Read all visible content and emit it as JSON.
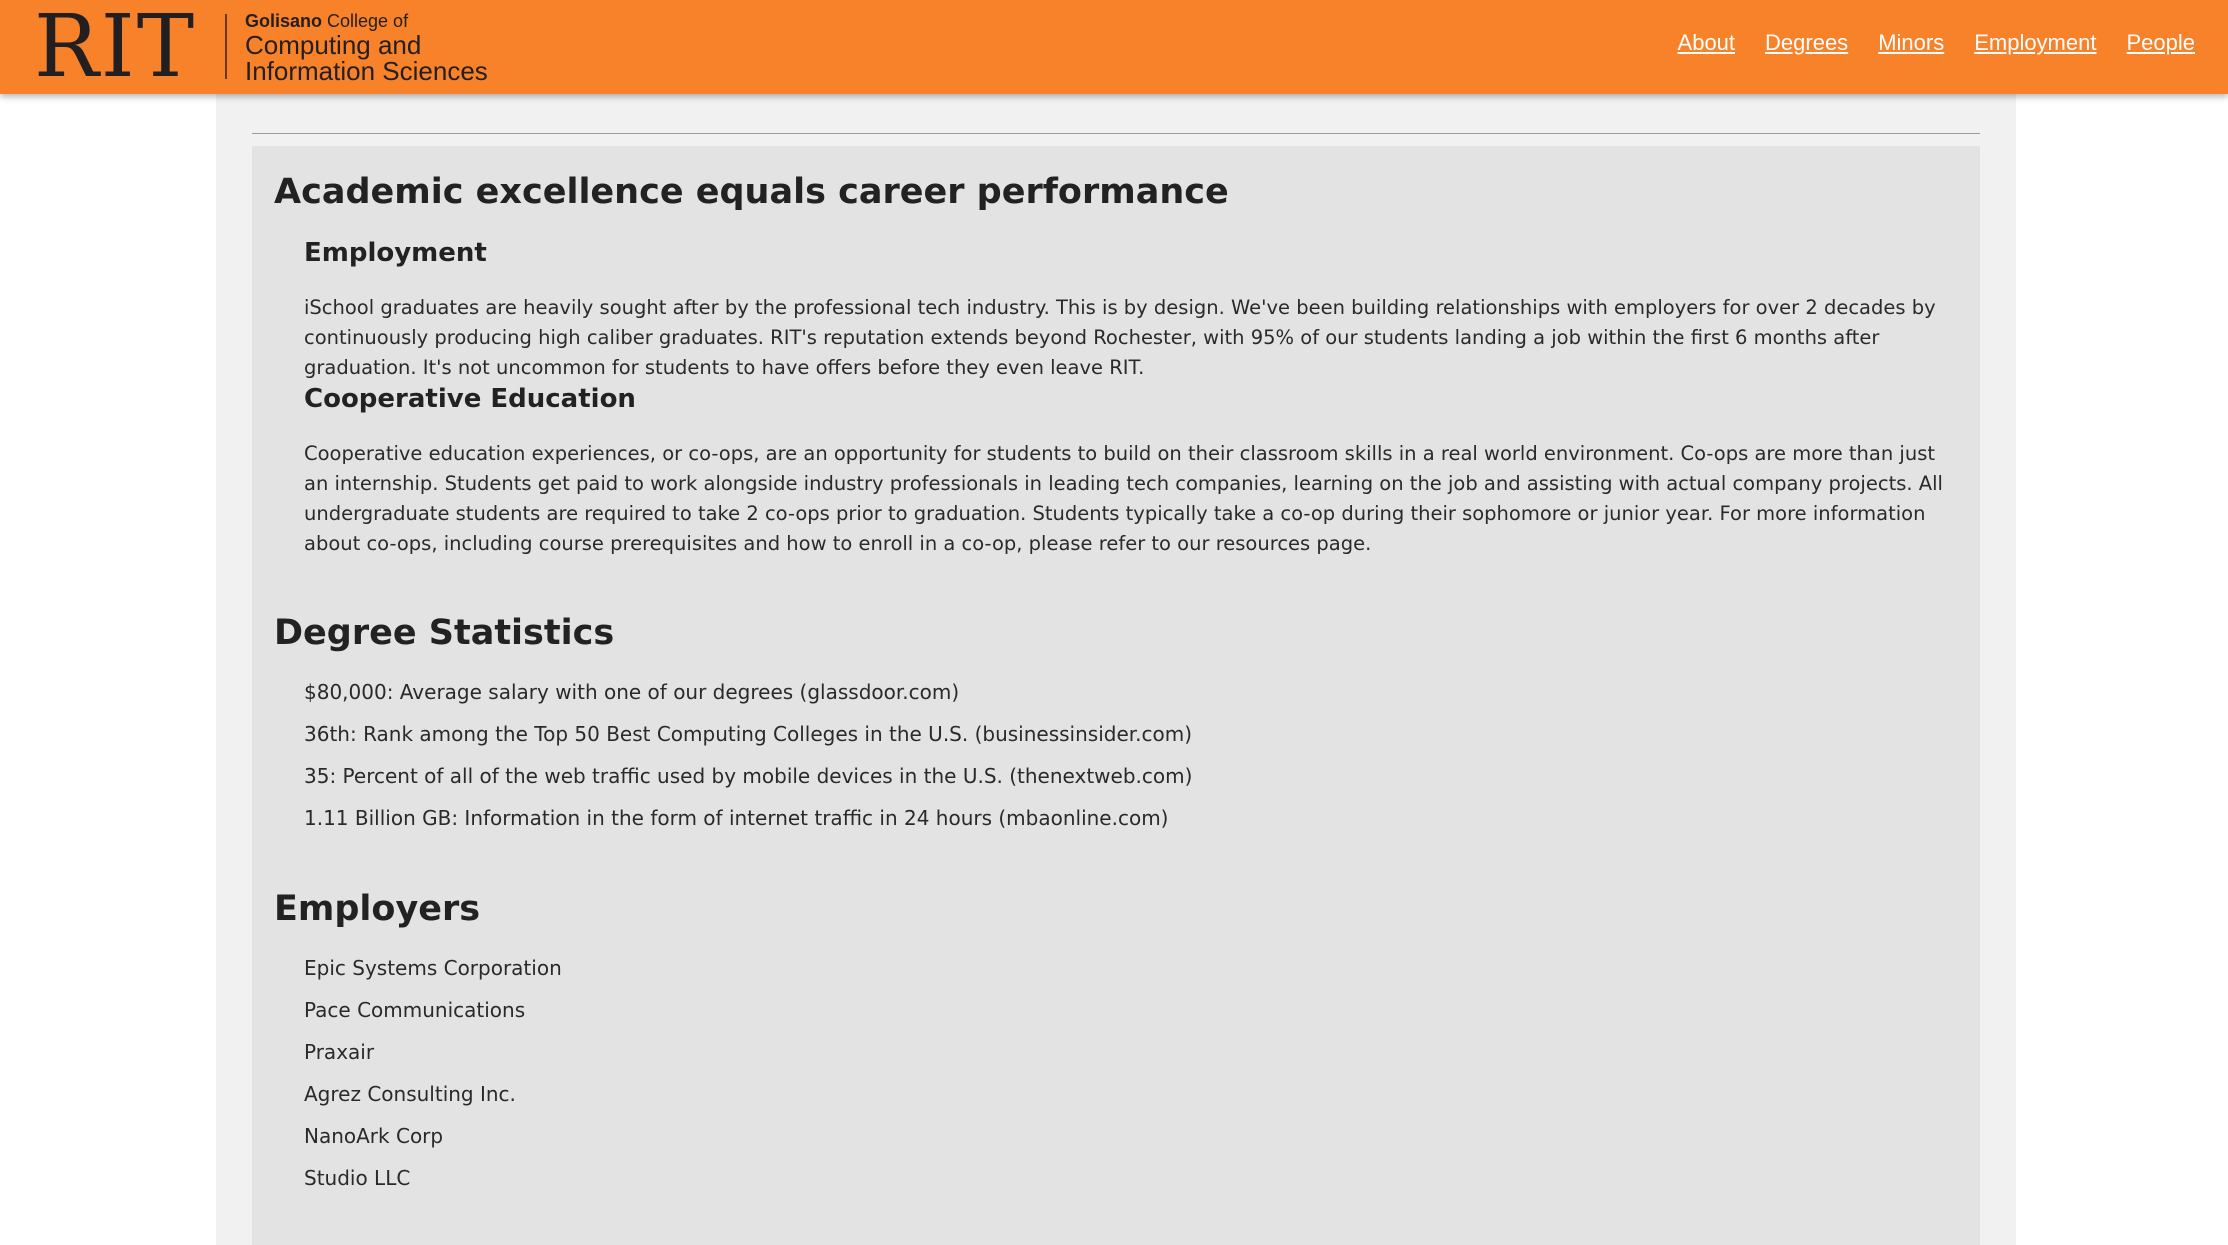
{
  "header": {
    "logo_mark": "RIT",
    "college_bold": "Golisano",
    "college_rest": " College of",
    "college_line2": "Computing and",
    "college_line3": "Information Sciences",
    "nav": [
      "About",
      "Degrees",
      "Minors",
      "Employment",
      "People"
    ]
  },
  "colors": {
    "accent": "#f8822a",
    "panel": "#e4e3e4",
    "frame": "#f1f1f1"
  },
  "intro": {
    "title": "Academic excellence equals career performance",
    "employment_heading": "Employment",
    "employment_text": "iSchool graduates are heavily sought after by the professional tech industry. This is by design. We've been building relationships with employers for over 2 decades by continuously producing high caliber graduates. RIT's reputation extends beyond Rochester, with 95% of our students landing a job within the first 6 months after graduation. It's not uncommon for students to have offers before they even leave RIT.",
    "coop_heading": "Cooperative Education",
    "coop_text": "Cooperative education experiences, or co-ops, are an opportunity for students to build on their classroom skills in a real world environment. Co-ops are more than just an internship. Students get paid to work alongside industry professionals in leading tech companies, learning on the job and assisting with actual company projects. All undergraduate students are required to take 2 co-ops prior to graduation. Students typically take a co-op during their sophomore or junior year. For more information about co-ops, including course prerequisites and how to enroll in a co-op, please refer to our resources page."
  },
  "degree_stats": {
    "title": "Degree Statistics",
    "items": [
      "$80,000: Average salary with one of our degrees (glassdoor.com)",
      "36th: Rank among the Top 50 Best Computing Colleges in the U.S. (businessinsider.com)",
      "35: Percent of all of the web traffic used by mobile devices in the U.S. (thenextweb.com)",
      "1.11 Billion GB: Information in the form of internet traffic in 24 hours (mbaonline.com)"
    ]
  },
  "employers": {
    "title": "Employers",
    "items": [
      "Epic Systems Corporation",
      "Pace Communications",
      "Praxair",
      "Agrez Consulting Inc.",
      "NanoArk Corp",
      "Studio LLC"
    ]
  }
}
